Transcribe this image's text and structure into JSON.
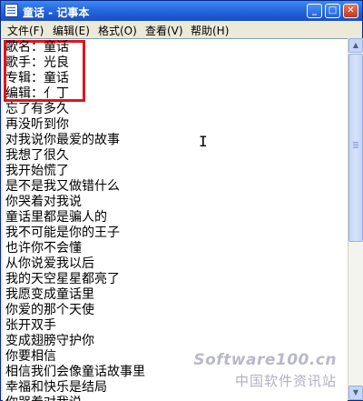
{
  "window": {
    "title": "童话 - 记事本",
    "minimize_icon": "minimize-icon",
    "maximize_icon": "maximize-icon",
    "close_icon": "close-icon",
    "minimize_glyph": "_",
    "maximize_glyph": "□",
    "close_glyph": "✕"
  },
  "menu": {
    "file": "文件(F)",
    "edit": "编辑(E)",
    "format": "格式(O)",
    "view": "查看(V)",
    "help": "帮助(H)"
  },
  "document": {
    "lines": [
      "歌名：童话",
      "歌手：光良",
      "专辑：童话",
      "编辑：亻丁",
      "忘了有多久",
      "再没听到你",
      "对我说你最爱的故事",
      "我想了很久",
      "我开始慌了",
      "是不是我又做错什么",
      "你哭着对我说",
      "童话里都是骗人的",
      "我不可能是你的王子",
      "也许你不会懂",
      "从你说爱我以后",
      "我的天空星星都亮了",
      "我愿变成童话里",
      "你爱的那个天使",
      "张开双手",
      "变成翅膀守护你",
      "你要相信",
      "相信我们会像童话故事里",
      "幸福和快乐是结局",
      "你哭着对我说"
    ]
  },
  "cursor_glyph": "I",
  "watermark": {
    "en": "Software100.cn",
    "cn": "中国软件资讯站"
  },
  "colors": {
    "titlebar": "#245edb",
    "highlight": "#e1141d"
  }
}
